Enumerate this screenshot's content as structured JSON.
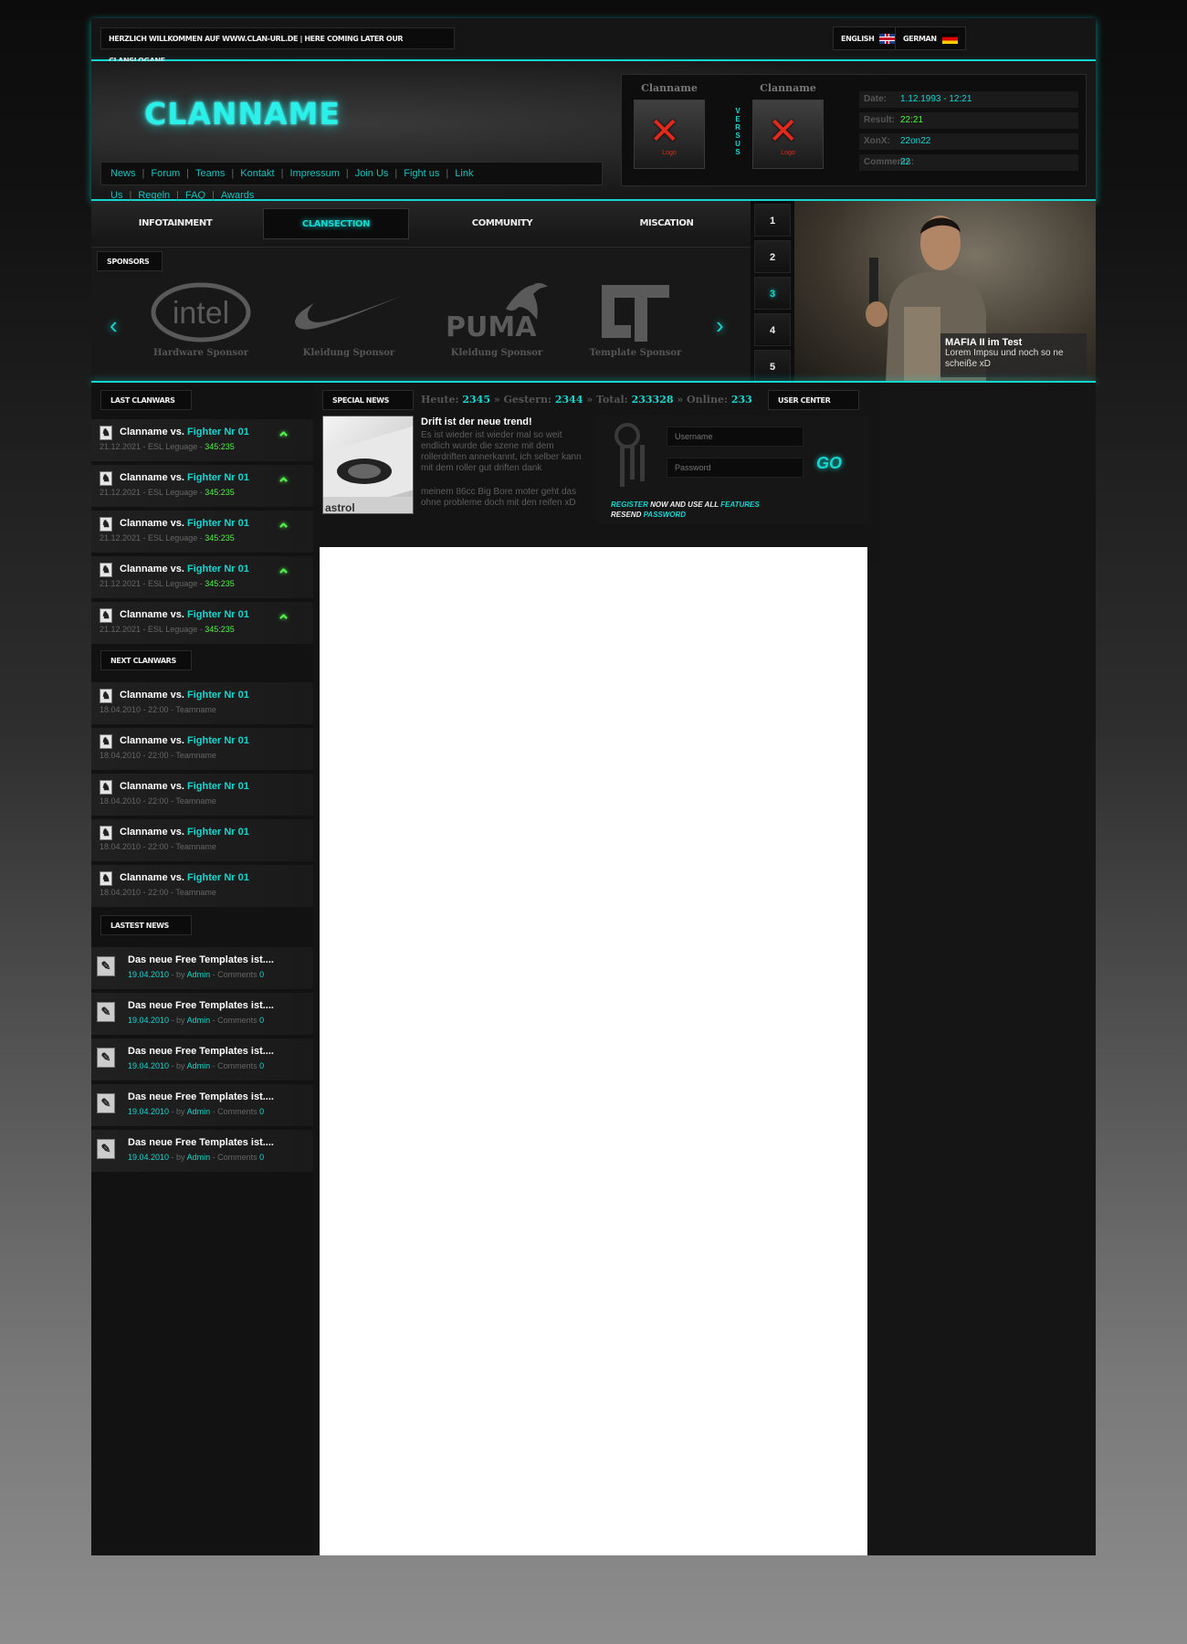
{
  "topbar": {
    "welcome": "HERZLICH WILLKOMMEN AUF WWW.CLAN-URL.DE | HERE COMING LATER OUR CLANSLOGANE",
    "lang_english": "ENGLISH",
    "lang_german": "GERMAN"
  },
  "header": {
    "logo": "CLANNAME",
    "nav": [
      "News",
      "Forum",
      "Teams",
      "Kontakt",
      "Impressum",
      "Join Us",
      "Fight us",
      "Link Us",
      "Regeln",
      "FAQ",
      "Awards"
    ]
  },
  "versus": {
    "team1": "Clanname",
    "team2": "Clanname",
    "logo_text": "Logo",
    "vs_word": "VERSUS",
    "rows": [
      {
        "label": "Date:",
        "value": "1.12.1993 - 12:21"
      },
      {
        "label": "Result:",
        "value": "22:21"
      },
      {
        "label": "XonX:",
        "value": "22on22"
      },
      {
        "label": "Comments:",
        "value": "22"
      }
    ]
  },
  "menu": [
    "INFOTAINMENT",
    "CLANSECTION",
    "COMMUNITY",
    "MISCATION"
  ],
  "menu_active": "CLANSECTION",
  "sponsors": {
    "heading": "SPONSORS",
    "items": [
      {
        "logo": "intel",
        "caption": "Hardware Sponsor"
      },
      {
        "logo": "",
        "caption": "Kleidung Sponsor"
      },
      {
        "logo": "PUMA",
        "caption": "Kleidung Sponsor"
      },
      {
        "logo": "",
        "caption": "Template Sponsor"
      }
    ],
    "prev": "‹",
    "next": "›"
  },
  "slider": {
    "numbers": [
      "1",
      "2",
      "3",
      "4",
      "5"
    ],
    "active": "3",
    "caption_title": "MAFIA II im Test",
    "caption_text": "Lorem Impsu und noch so ne scheiße xD"
  },
  "last_clanwars": {
    "heading": "LAST CLANWARS",
    "items": [
      {
        "team": "Clanname vs. ",
        "opponent": "Fighter Nr 01",
        "meta": "21.12.2021 - ESL Leguage - ",
        "score": "345:235"
      },
      {
        "team": "Clanname vs. ",
        "opponent": "Fighter Nr 01",
        "meta": "21.12.2021 - ESL Leguage - ",
        "score": "345:235"
      },
      {
        "team": "Clanname vs. ",
        "opponent": "Fighter Nr 01",
        "meta": "21.12.2021 - ESL Leguage - ",
        "score": "345:235"
      },
      {
        "team": "Clanname vs. ",
        "opponent": "Fighter Nr 01",
        "meta": "21.12.2021 - ESL Leguage - ",
        "score": "345:235"
      },
      {
        "team": "Clanname vs. ",
        "opponent": "Fighter Nr 01",
        "meta": "21.12.2021 - ESL Leguage - ",
        "score": "345:235"
      }
    ]
  },
  "next_clanwars": {
    "heading": "NEXT CLANWARS",
    "items": [
      {
        "team": "Clanname vs. ",
        "opponent": "Fighter Nr 01",
        "meta": "18.04.2010 - 22:00 - Teamname"
      },
      {
        "team": "Clanname vs. ",
        "opponent": "Fighter Nr 01",
        "meta": "18.04.2010 - 22:00 - Teamname"
      },
      {
        "team": "Clanname vs. ",
        "opponent": "Fighter Nr 01",
        "meta": "18.04.2010 - 22:00 - Teamname"
      },
      {
        "team": "Clanname vs. ",
        "opponent": "Fighter Nr 01",
        "meta": "18.04.2010 - 22:00 - Teamname"
      },
      {
        "team": "Clanname vs. ",
        "opponent": "Fighter Nr 01",
        "meta": "18.04.2010 - 22:00 - Teamname"
      }
    ]
  },
  "latest_news": {
    "heading": "LASTEST NEWS",
    "items": [
      {
        "title": "Das neue Free Templates ist....",
        "date": "19.04.2010",
        "by": " - by ",
        "author": "Admin",
        "comments_label": " - Comments ",
        "comments": "0"
      },
      {
        "title": "Das neue Free Templates ist....",
        "date": "19.04.2010",
        "by": " - by ",
        "author": "Admin",
        "comments_label": " - Comments ",
        "comments": "0"
      },
      {
        "title": "Das neue Free Templates ist....",
        "date": "19.04.2010",
        "by": " - by ",
        "author": "Admin",
        "comments_label": " - Comments ",
        "comments": "0"
      },
      {
        "title": "Das neue Free Templates ist....",
        "date": "19.04.2010",
        "by": " - by ",
        "author": "Admin",
        "comments_label": " - Comments ",
        "comments": "0"
      },
      {
        "title": "Das neue Free Templates ist....",
        "date": "19.04.2010",
        "by": " - by ",
        "author": "Admin",
        "comments_label": " - Comments ",
        "comments": "0"
      }
    ]
  },
  "special_news": {
    "heading": "SPECIAL NEWS",
    "title": "Drift ist der neue trend!",
    "text1": "Es ist wieder ist wieder mal so weit endlich wurde die szene mit dem rollerdriften annerkannt, ich selber kann mit dem roller gut driften dank",
    "text2": "meinem 86cc Big Bore moter geht das ohne probleme doch mit den reifen xD"
  },
  "stats": {
    "heute_label": "Heute: ",
    "heute": "2345",
    "gestern_label": " » Gestern: ",
    "gestern": "2344",
    "total_label": " » Total: ",
    "total": "233328",
    "online_label": " » Online: ",
    "online": "233"
  },
  "user_center": {
    "heading": "USER CENTER",
    "username_placeholder": "Username",
    "password_placeholder": "Password",
    "go": "GO",
    "register": "REGISTER",
    "register_rest": " NOW AND USE ALL ",
    "features": "FEATURES",
    "resend": "RESEND ",
    "password_link": "PASSWORD"
  },
  "colors": {
    "accent": "#16d6d0",
    "score_green": "#52f04a",
    "logo_red": "#e3281c"
  }
}
